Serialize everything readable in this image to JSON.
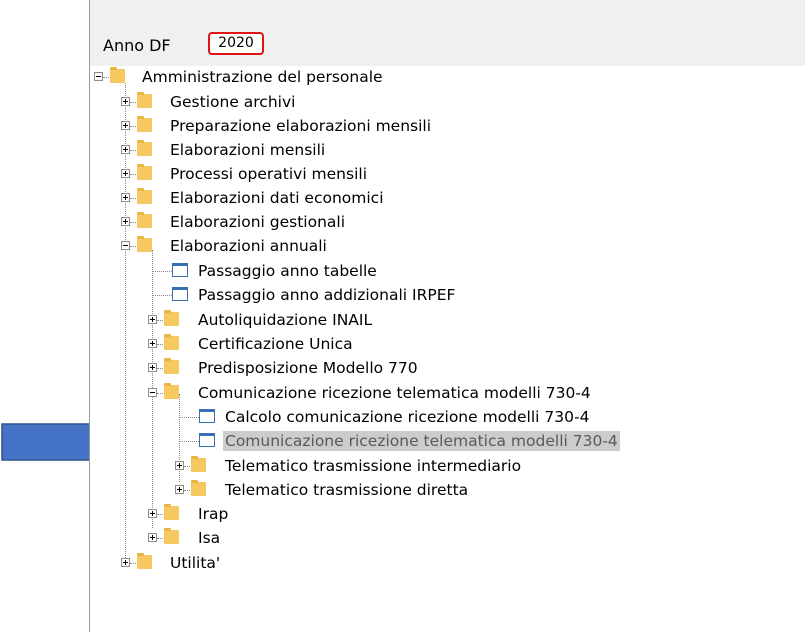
{
  "filter": {
    "label": "Anno DF",
    "value": "2020"
  },
  "tree": {
    "root": "Amministrazione del personale",
    "gestione_archivi": "Gestione archivi",
    "preparazione": "Preparazione elaborazioni mensili",
    "elab_mensili": "Elaborazioni mensili",
    "processi": "Processi operativi mensili",
    "dati_economici": "Elaborazioni dati economici",
    "gestionali": "Elaborazioni gestionali",
    "annuali": "Elaborazioni annuali",
    "passaggio_tabelle": "Passaggio anno tabelle",
    "passaggio_irpef": "Passaggio anno addizionali IRPEF",
    "inail": "Autoliquidazione INAIL",
    "cu": "Certificazione Unica",
    "m770": "Predisposizione Modello 770",
    "comunicazione": "Comunicazione ricezione telematica modelli 730-4",
    "calcolo": "Calcolo comunicazione ricezione modelli 730-4",
    "comunicazione_sel": "Comunicazione ricezione telematica modelli 730-4",
    "intermediario": "Telematico trasmissione intermediario",
    "diretta": "Telematico trasmissione diretta",
    "irap": "Irap",
    "isa": "Isa",
    "utilita": "Utilita'"
  },
  "colors": {
    "arrow": "#4472c4",
    "highlight_border": "#e01414",
    "selection": "#cccccc",
    "folder": "#f6c860"
  }
}
